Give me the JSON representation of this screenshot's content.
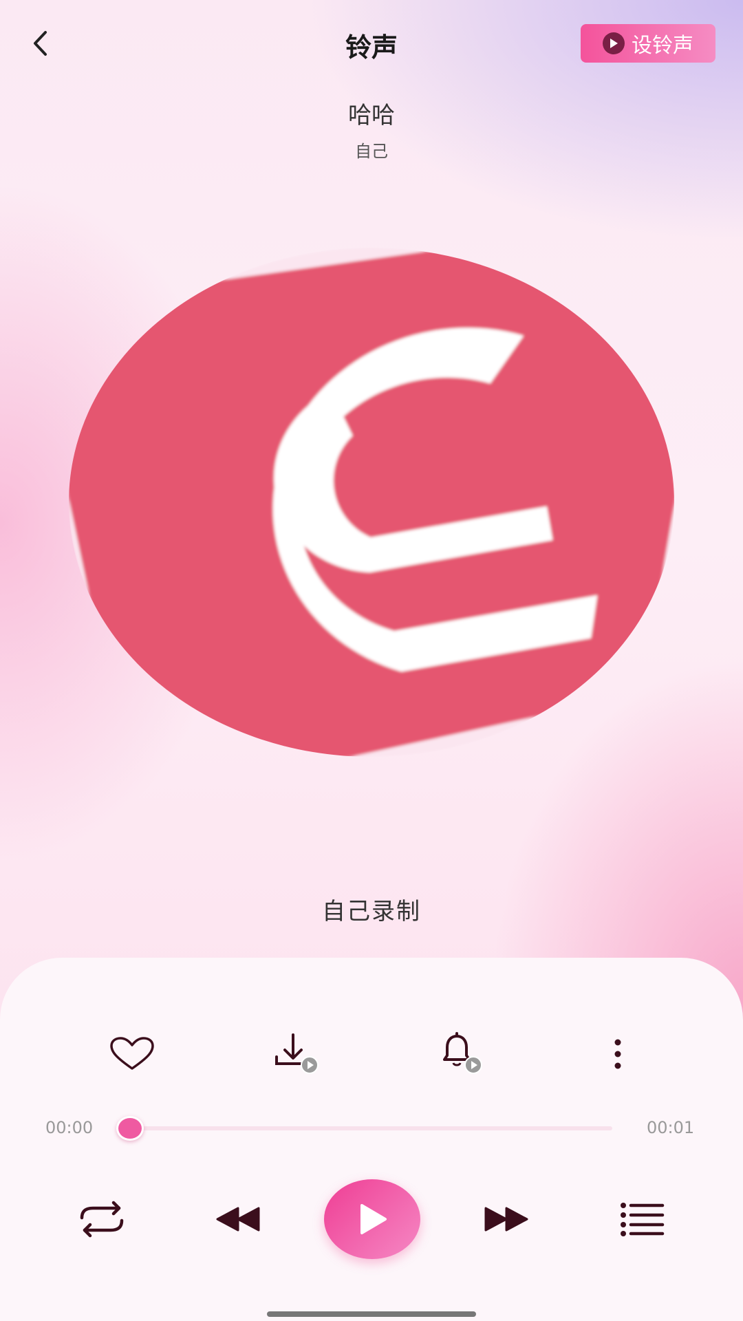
{
  "header": {
    "title": "铃声",
    "set_ringtone_label": "设铃声"
  },
  "song": {
    "title": "哈哈",
    "artist": "自己"
  },
  "cover": {
    "brand_color": "#e5566f",
    "icon": "app-logo-c"
  },
  "lyric": "自己录制",
  "actions": [
    {
      "name": "like",
      "icon": "heart-icon"
    },
    {
      "name": "download",
      "icon": "download-icon"
    },
    {
      "name": "set-bell",
      "icon": "bell-icon"
    },
    {
      "name": "more",
      "icon": "more-vertical-icon"
    }
  ],
  "progress": {
    "current": "00:00",
    "total": "00:01",
    "fraction": 0
  },
  "controls": {
    "repeat_icon": "repeat-icon",
    "prev_icon": "rewind-icon",
    "play_icon": "play-icon",
    "next_icon": "fast-forward-icon",
    "playlist_icon": "playlist-icon"
  },
  "colors": {
    "accent": "#f4539b",
    "dark_icon": "#3b0e1c"
  }
}
